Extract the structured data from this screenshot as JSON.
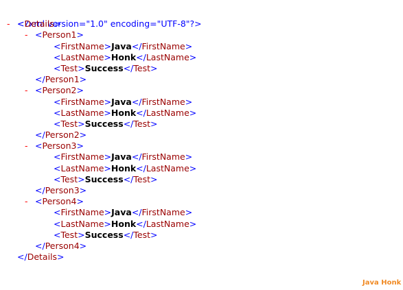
{
  "xml": {
    "declaration": "<?xml version=\"1.0\" encoding=\"UTF-8\"?>",
    "collapse_glyph": "-",
    "root": {
      "tag": "Details",
      "children": [
        {
          "tag": "Person1",
          "fields": [
            {
              "tag": "FirstName",
              "value": "Java"
            },
            {
              "tag": "LastName",
              "value": "Honk"
            },
            {
              "tag": "Test",
              "value": "Success"
            }
          ]
        },
        {
          "tag": "Person2",
          "fields": [
            {
              "tag": "FirstName",
              "value": "Java"
            },
            {
              "tag": "LastName",
              "value": "Honk"
            },
            {
              "tag": "Test",
              "value": "Success"
            }
          ]
        },
        {
          "tag": "Person3",
          "fields": [
            {
              "tag": "FirstName",
              "value": "Java"
            },
            {
              "tag": "LastName",
              "value": "Honk"
            },
            {
              "tag": "Test",
              "value": "Success"
            }
          ]
        },
        {
          "tag": "Person4",
          "fields": [
            {
              "tag": "FirstName",
              "value": "Java"
            },
            {
              "tag": "LastName",
              "value": "Honk"
            },
            {
              "tag": "Test",
              "value": "Success"
            }
          ]
        }
      ]
    }
  },
  "watermark": "Java Honk",
  "colors": {
    "bracket": "#0000ff",
    "tag_name": "#990000",
    "toggle": "#ff0000",
    "value": "#000000",
    "watermark": "#f08a24"
  }
}
